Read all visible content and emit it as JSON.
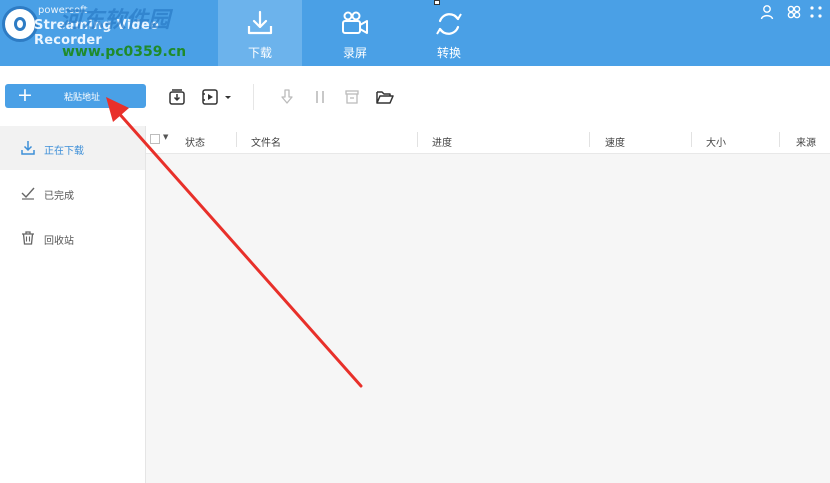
{
  "header": {
    "brand_small": "powersoft",
    "app_name": "Streaming Video Recorder",
    "watermark_cn": "河东软件园",
    "watermark_url": "www.pc0359.cn",
    "tabs": [
      {
        "label": "下载",
        "icon": "download-tray-icon",
        "active": true
      },
      {
        "label": "录屏",
        "icon": "video-camera-icon",
        "active": false
      },
      {
        "label": "转换",
        "icon": "convert-cycle-icon",
        "active": false
      }
    ],
    "right_icons": [
      "user-icon",
      "settings-cluster-icon",
      "more-icon"
    ]
  },
  "toolbar": {
    "add_button_plus": "+",
    "add_button_label": "粘贴地址",
    "icons": [
      "download-box-icon",
      "video-file-icon",
      "dropdown-caret-icon",
      "download-arrow-icon",
      "pause-icon",
      "delete-icon",
      "open-folder-icon"
    ]
  },
  "sidebar": {
    "items": [
      {
        "label": "正在下载",
        "icon": "download-icon",
        "active": true
      },
      {
        "label": "已完成",
        "icon": "check-icon",
        "active": false
      },
      {
        "label": "回收站",
        "icon": "trash-icon",
        "active": false
      }
    ]
  },
  "table": {
    "columns": [
      "状态",
      "文件名",
      "进度",
      "速度",
      "大小",
      "来源"
    ]
  },
  "colors": {
    "accent": "#4aa0e6",
    "active_tab": "#6cb3ec",
    "annotation": "#e8302a"
  }
}
